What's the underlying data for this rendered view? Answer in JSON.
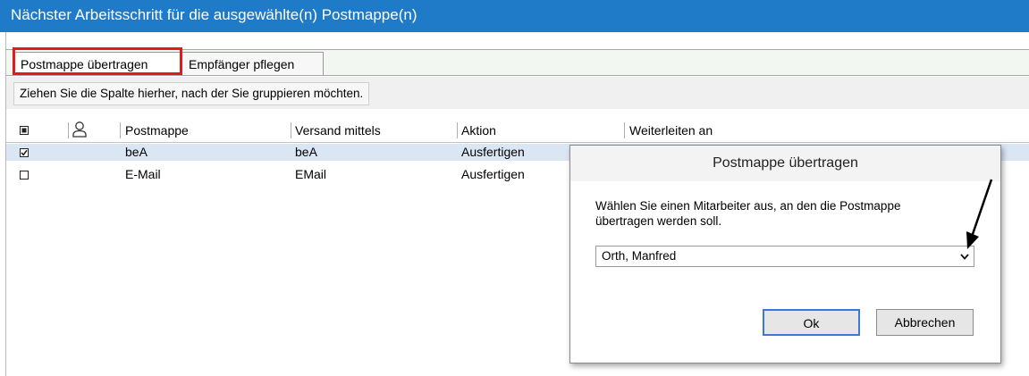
{
  "window": {
    "title": "Nächster Arbeitsschritt für die ausgewählte(n) Postmappe(n)"
  },
  "tabs": [
    {
      "label": "Postmappe übertragen",
      "active": true
    },
    {
      "label": "Empfänger pflegen",
      "active": false
    }
  ],
  "group_hint": "Ziehen Sie die Spalte hierher, nach der Sie gruppieren möchten.",
  "grid": {
    "columns": [
      "Postmappe",
      "Versand mittels",
      "Aktion",
      "Weiterleiten an"
    ],
    "header_icons": [
      "select-all-checkbox-icon",
      "person-icon"
    ],
    "rows": [
      {
        "checked": true,
        "postmappe": "beA",
        "versand": "beA",
        "aktion": "Ausfertigen"
      },
      {
        "checked": false,
        "postmappe": "E-Mail",
        "versand": "EMail",
        "aktion": "Ausfertigen"
      }
    ]
  },
  "dialog": {
    "title": "Postmappe übertragen",
    "message": "Wählen Sie einen Mitarbeiter aus, an den die Postmappe übertragen werden soll.",
    "selected_employee": "Orth, Manfred",
    "ok_label": "Ok",
    "cancel_label": "Abbrechen"
  },
  "colors": {
    "titlebar": "#1f7ac7",
    "highlight_box": "#e21a1a",
    "selected_row": "#dbe6f5"
  }
}
